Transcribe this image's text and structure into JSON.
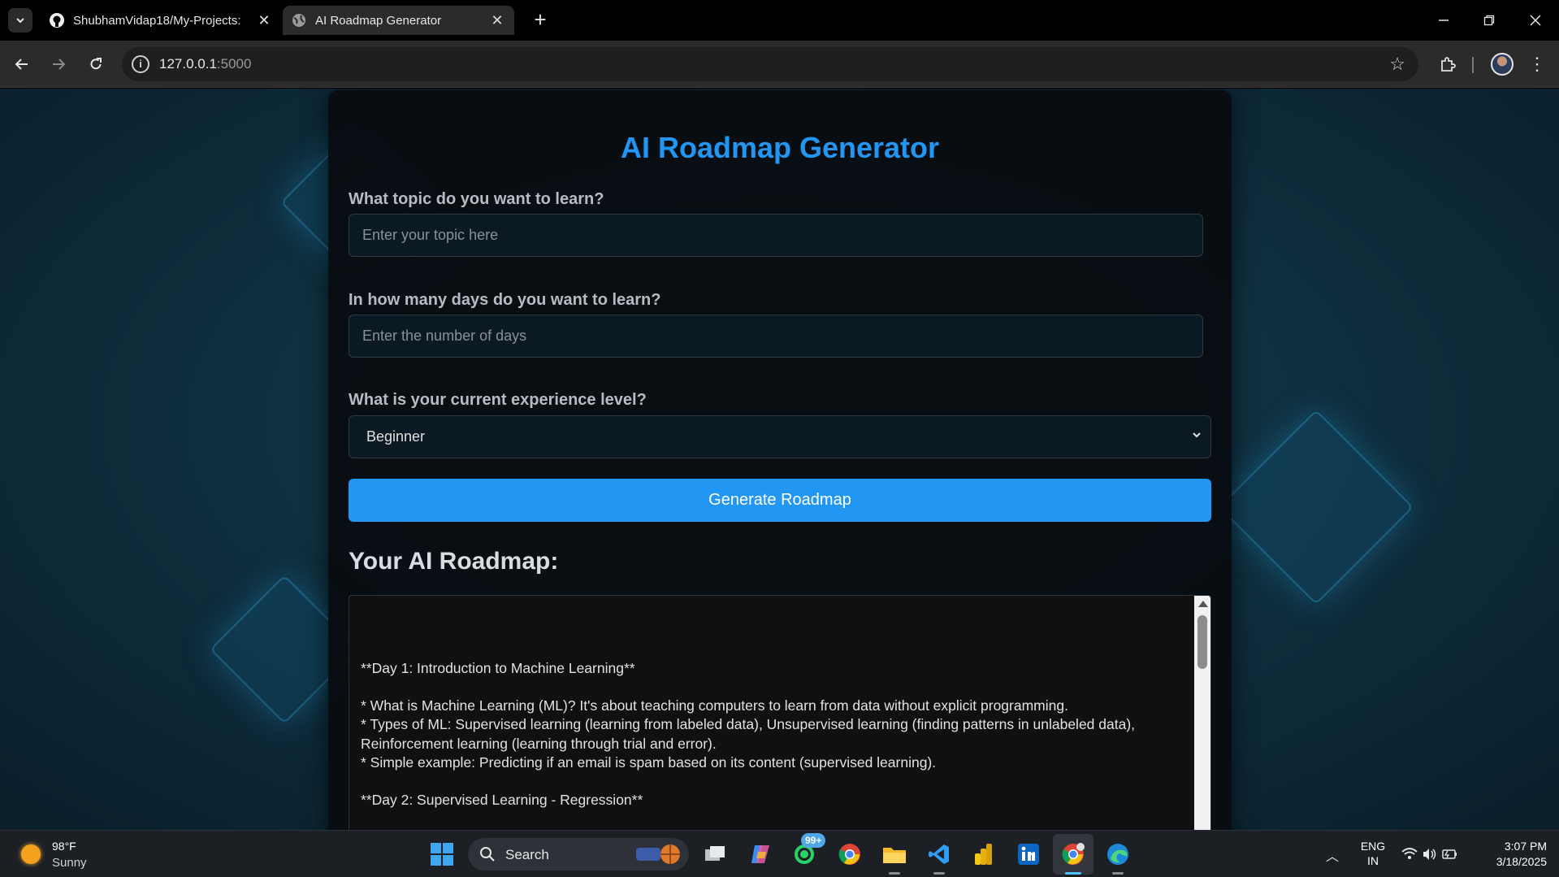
{
  "browser": {
    "tabs": [
      {
        "title": "ShubhamVidap18/My-Projects:",
        "icon": "github-icon",
        "active": false
      },
      {
        "title": "AI Roadmap Generator",
        "icon": "globe-icon",
        "active": true
      }
    ],
    "url_host": "127.0.0.1",
    "url_port": ":5000"
  },
  "page": {
    "title": "AI Roadmap Generator",
    "topic_label": "What topic do you want to learn?",
    "topic_placeholder": "Enter your topic here",
    "days_label": "In how many days do you want to learn?",
    "days_placeholder": "Enter the number of days",
    "level_label": "What is your current experience level?",
    "level_selected": "Beginner",
    "generate_button": "Generate Roadmap",
    "roadmap_heading": "Your AI Roadmap:",
    "roadmap_lines": [
      "**Day 1: Introduction to Machine Learning**",
      "",
      "* What is Machine Learning (ML)?  It's about teaching computers to learn from data without explicit programming.",
      "* Types of ML: Supervised learning (learning from labeled data), Unsupervised learning (finding patterns in unlabeled data), Reinforcement learning (learning through trial and error).",
      "* Simple example: Predicting if an email is spam based on its content (supervised learning).",
      "",
      "**Day 2: Supervised Learning - Regression**"
    ]
  },
  "taskbar": {
    "weather_temp": "98°F",
    "weather_desc": "Sunny",
    "search_label": "Search",
    "whatsapp_badge": "99+",
    "lang_line1": "ENG",
    "lang_line2": "IN",
    "time": "3:07 PM",
    "date": "3/18/2025"
  },
  "colors": {
    "accent": "#2196f3",
    "card_bg": "#080c10",
    "page_bg": "#0f3040"
  }
}
